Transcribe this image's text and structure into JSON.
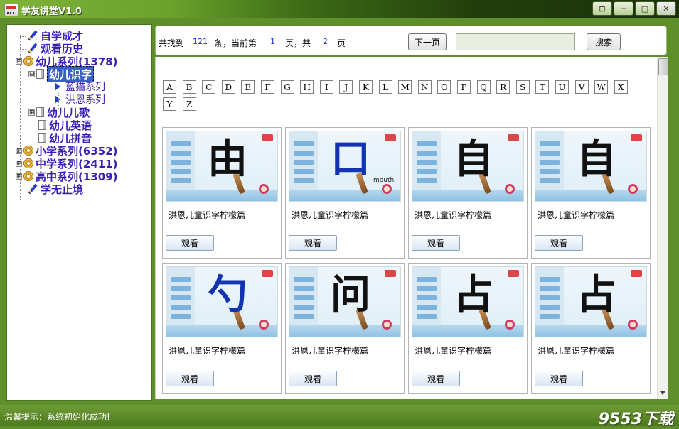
{
  "window": {
    "title": "学友讲堂V1.0",
    "buttons": [
      "⊟",
      "─",
      "□",
      "✕"
    ]
  },
  "tree": {
    "items": [
      {
        "label": "自学成才",
        "icon": "pencil-icon"
      },
      {
        "label": "观看历史",
        "icon": "pencil-icon"
      },
      {
        "label": "幼儿系列(1378)",
        "icon": "disc-icon",
        "toggle": "⊟"
      },
      {
        "label": "幼儿识字",
        "icon": "page-icon",
        "toggle": "⊟",
        "selected": true
      },
      {
        "label": "蓝猫系列",
        "icon": "arrow-icon"
      },
      {
        "label": "洪恩系列",
        "icon": "arrow-icon"
      },
      {
        "label": "幼儿儿歌",
        "icon": "page-icon",
        "toggle": "⊞"
      },
      {
        "label": "幼儿英语",
        "icon": "page-icon"
      },
      {
        "label": "幼儿拼音",
        "icon": "page-icon"
      },
      {
        "label": "小学系列(6352)",
        "icon": "disc-icon",
        "toggle": "⊞"
      },
      {
        "label": "中学系列(2411)",
        "icon": "disc-icon",
        "toggle": "⊞"
      },
      {
        "label": "高中系列(1309)",
        "icon": "disc-icon",
        "toggle": "⊞"
      },
      {
        "label": "学无止境",
        "icon": "pencil-icon"
      }
    ]
  },
  "toolbar": {
    "found_prefix": "共找到",
    "found_count": "121",
    "found_suffix": "条，当前第",
    "current_page": "1",
    "page_mid": "页，共",
    "total_pages": "2",
    "page_suffix": "页",
    "next_label": "下一页",
    "search_value": "",
    "search_label": "搜索"
  },
  "letters": [
    "A",
    "B",
    "C",
    "D",
    "E",
    "F",
    "G",
    "H",
    "I",
    "J",
    "K",
    "L",
    "M",
    "N",
    "O",
    "P",
    "Q",
    "R",
    "S",
    "T",
    "U",
    "V",
    "W",
    "X",
    "Y",
    "Z"
  ],
  "cards": [
    {
      "char": "由",
      "title": "洪恩儿童识字柠檬篇",
      "button": "观看",
      "color": "black"
    },
    {
      "char": "口",
      "title": "洪恩儿童识字柠檬篇",
      "button": "观看",
      "color": "blue",
      "caption": "mouth"
    },
    {
      "char": "自",
      "title": "洪恩儿童识字柠檬篇",
      "button": "观看",
      "color": "black"
    },
    {
      "char": "自",
      "title": "洪恩儿童识字柠檬篇",
      "button": "观看",
      "color": "black"
    },
    {
      "char": "勺",
      "title": "洪恩儿童识字柠檬篇",
      "button": "观看",
      "color": "blue"
    },
    {
      "char": "问",
      "title": "洪恩儿童识字柠檬篇",
      "button": "观看",
      "color": "black"
    },
    {
      "char": "占",
      "title": "洪恩儿童识字柠檬篇",
      "button": "观看",
      "color": "black"
    },
    {
      "char": "占",
      "title": "洪恩儿童识字柠檬篇",
      "button": "观看",
      "color": "black"
    }
  ],
  "status": {
    "text": "温馨提示：系统初始化成功!",
    "brand": "9553下载"
  }
}
